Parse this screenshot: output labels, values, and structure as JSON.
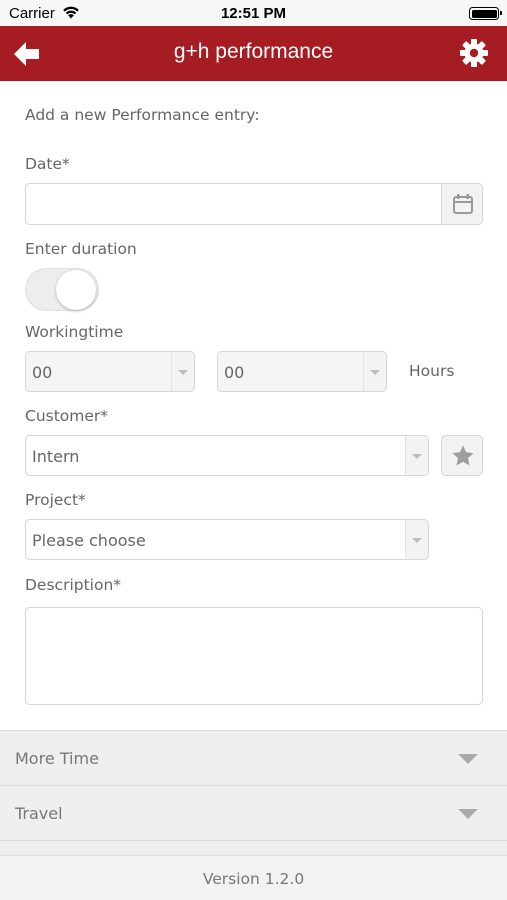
{
  "status_bar": {
    "carrier": "Carrier",
    "time": "12:51 PM"
  },
  "header": {
    "title": "g+h performance",
    "background": "#a51c22",
    "back_icon": "back-arrow-icon",
    "settings_icon": "gear-icon"
  },
  "form": {
    "intro": "Add a new Performance entry:",
    "date": {
      "label": "Date*",
      "value": "",
      "button_icon": "calendar-icon"
    },
    "duration": {
      "label": "Enter duration",
      "enabled": false
    },
    "workingtime": {
      "label": "Workingtime",
      "hours_value": "00",
      "minutes_value": "00",
      "unit": "Hours"
    },
    "customer": {
      "label": "Customer*",
      "value": "Intern",
      "favorite_icon": "star-icon"
    },
    "project": {
      "label": "Project*",
      "value": "Please choose"
    },
    "description": {
      "label": "Description*",
      "value": ""
    }
  },
  "accordions": [
    {
      "label": "More Time"
    },
    {
      "label": "Travel"
    }
  ],
  "footer": {
    "version": "Version 1.2.0"
  }
}
